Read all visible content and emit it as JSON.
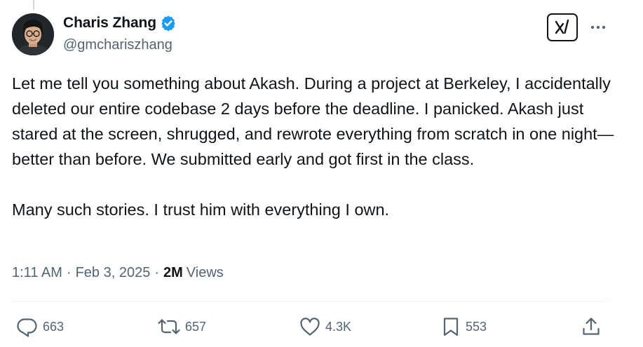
{
  "author": {
    "display_name": "Charis Zhang",
    "handle": "@gmchariszhang",
    "verified": true
  },
  "tweet": {
    "paragraphs": [
      "Let me tell you something about Akash. During a project at Berkeley, I accidentally deleted our entire codebase 2 days before the deadline. I panicked. Akash just stared at the screen, shrugged, and rewrote everything from scratch in one night—better than before. We submitted early and got first in the class.",
      "Many such stories. I trust him with everything I own."
    ],
    "time": "1:11 AM",
    "date": "Feb 3, 2025",
    "views_count": "2M",
    "views_label": "Views",
    "separator": "·"
  },
  "actions": {
    "replies": "663",
    "reposts": "657",
    "likes": "4.3K",
    "bookmarks": "553"
  },
  "icons": {
    "verified": "verified-badge-icon",
    "grok": "grok-icon",
    "more": "more-icon",
    "reply": "reply-icon",
    "repost": "repost-icon",
    "like": "like-icon",
    "bookmark": "bookmark-icon",
    "share": "share-icon"
  },
  "colors": {
    "text": "#0f1419",
    "secondary": "#536471",
    "verified": "#1d9bf0",
    "divider": "#eff3f4"
  }
}
